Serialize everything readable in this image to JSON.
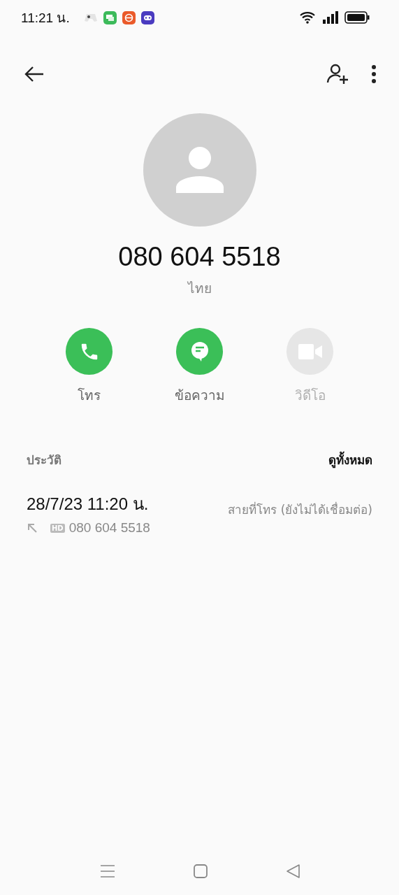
{
  "status_bar": {
    "time": "11:21 น."
  },
  "contact": {
    "number": "080 604 5518",
    "country": "ไทย"
  },
  "actions": [
    {
      "kind": "call",
      "label": "โทร",
      "disabled": false
    },
    {
      "kind": "message",
      "label": "ข้อความ",
      "disabled": false
    },
    {
      "kind": "video",
      "label": "วิดีโอ",
      "disabled": true
    }
  ],
  "history": {
    "title": "ประวัติ",
    "see_all": "ดูทั้งหมด",
    "entries": [
      {
        "datetime": "28/7/23 11:20 น.",
        "badge": "HD",
        "number": "080 604 5518",
        "status": "สายที่โทร (ยังไม่ได้เชื่อมต่อ)"
      }
    ]
  }
}
